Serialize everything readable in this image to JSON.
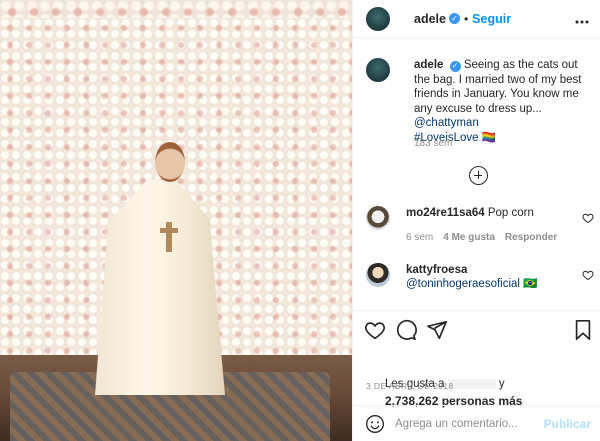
{
  "post": {
    "username": "adele",
    "follow_label": "Seguir",
    "more_icon": "more-options-icon",
    "caption_user": "adele",
    "caption_text": "Seeing as the cats out the bag. I married two of my best friends in January. You know me any excuse to dress up... ",
    "caption_mention": "@chattyman",
    "caption_hashtag": "#LoveisLove",
    "caption_emoji": "🏳️‍🌈",
    "caption_time": "183 sem"
  },
  "comments": [
    {
      "user": "mo24re11sa64",
      "text": "Pop corn",
      "time": "6 sem",
      "likes": "4 Me gusta",
      "reply_label": "Responder"
    },
    {
      "user": "kattyfroesa",
      "mention": "@toninhogeraesoficial",
      "emoji": "🇧🇷"
    }
  ],
  "actions": {
    "likes_line": "Les gusta a",
    "likes_line_suffix": "y",
    "likes_count": "2,738,262 personas más",
    "date": "3 DE ABRIL DE 2018"
  },
  "comment_box": {
    "placeholder": "Agrega un comentario...",
    "publish_label": "Publicar"
  },
  "colors": {
    "link": "#00376b",
    "follow": "#0095f6",
    "publish_disabled": "#b2dffc",
    "muted": "#8e8e8e"
  }
}
